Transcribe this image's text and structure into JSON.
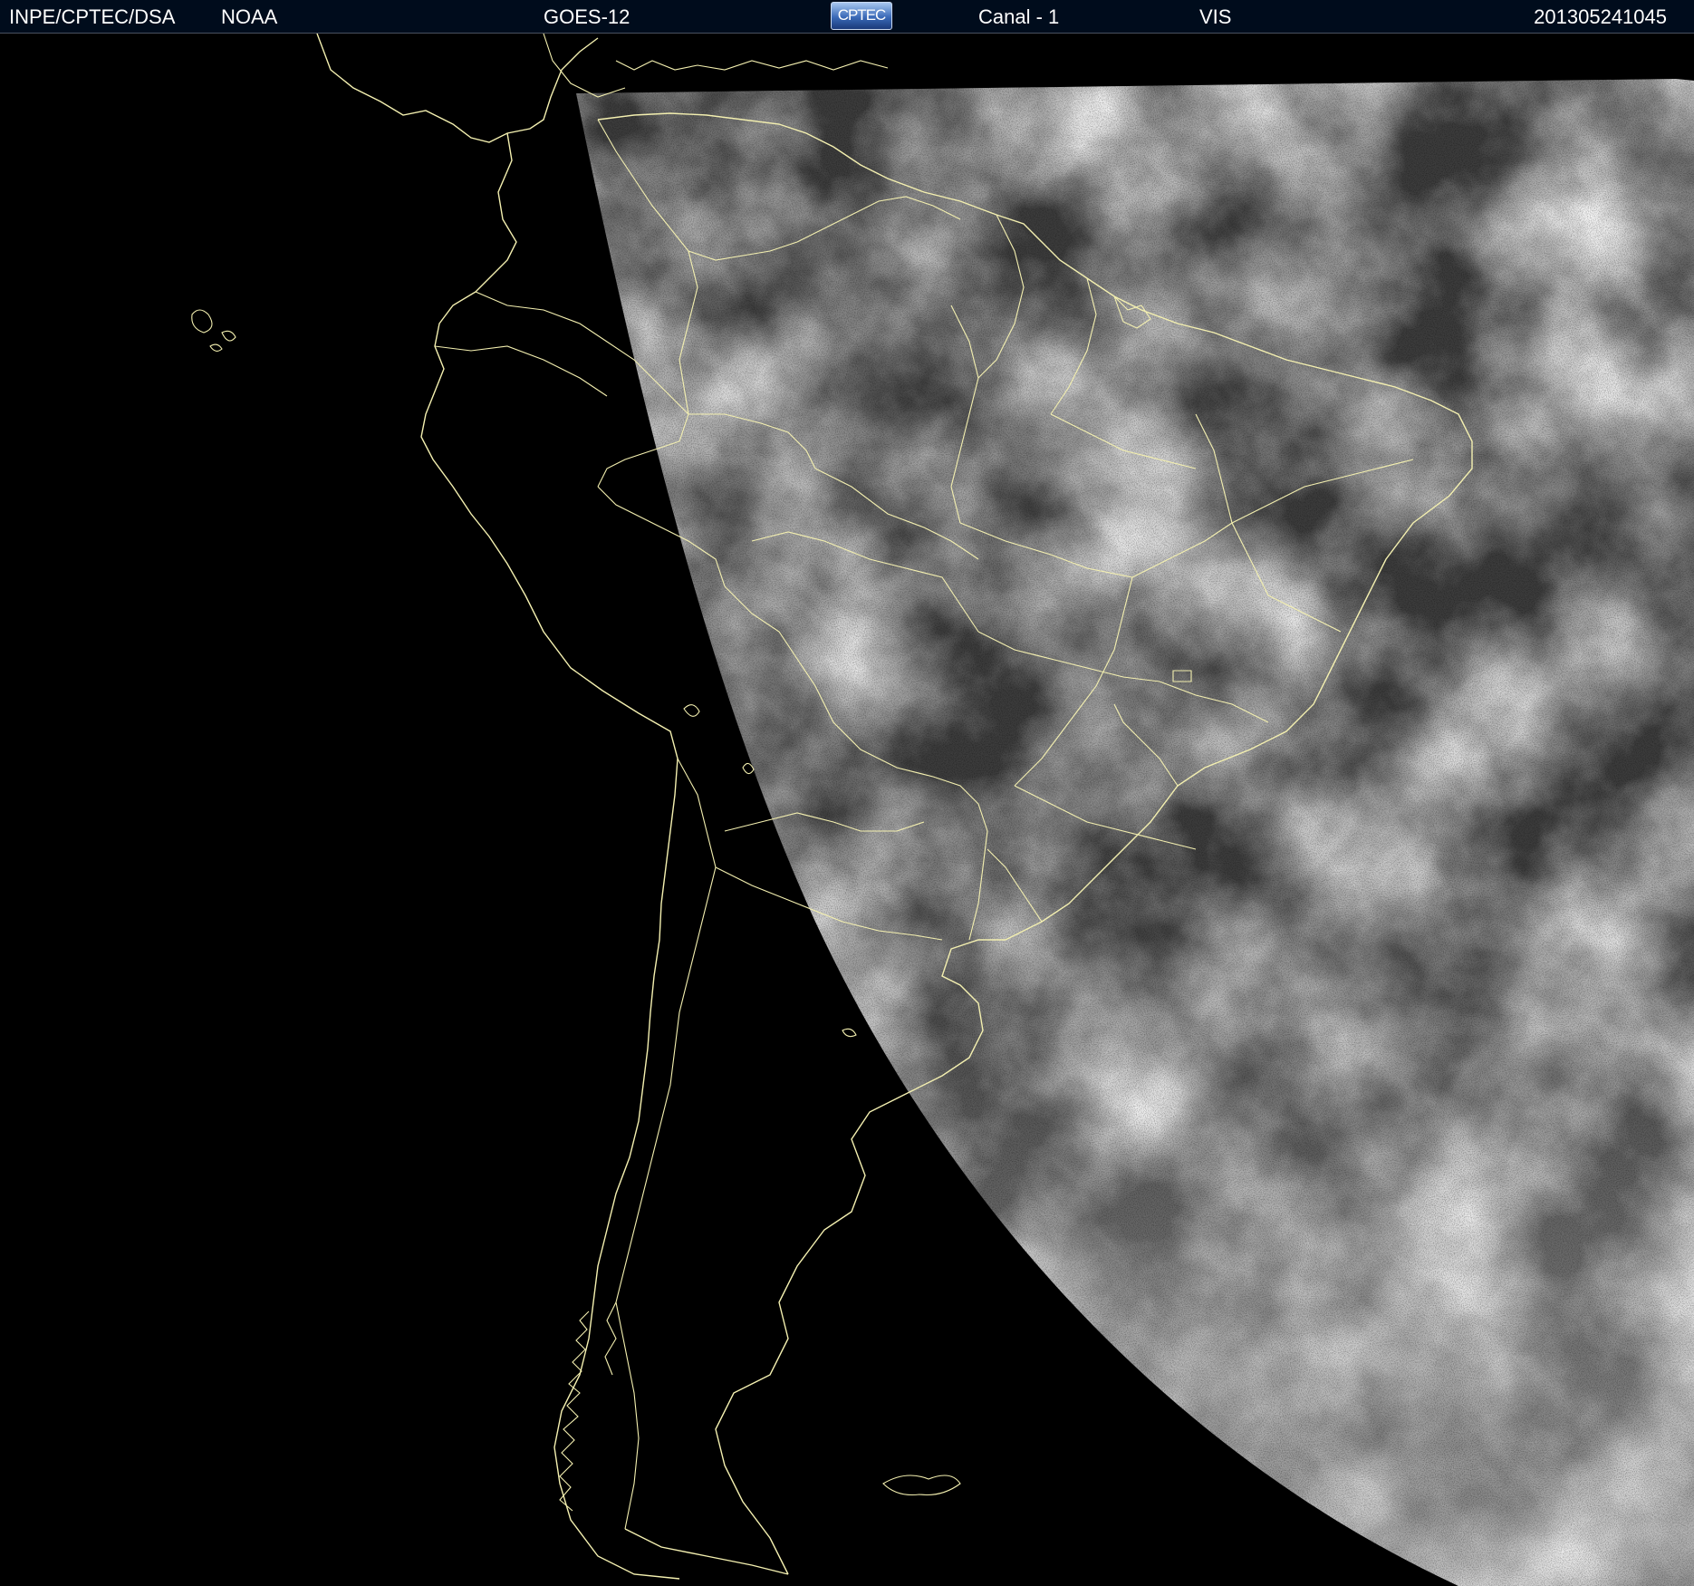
{
  "header": {
    "organization": "INPE/CPTEC/DSA",
    "agency": "NOAA",
    "satellite": "GOES-12",
    "logo_text": "CPTEC",
    "channel": "Canal - 1",
    "band": "VIS",
    "timestamp": "201305241045"
  },
  "image": {
    "kind": "visible-channel satellite image",
    "region": "South America",
    "colors": {
      "background": "#000000",
      "header_bg": "#000c1c",
      "borders": "#f4f0b0",
      "land_ocean": "#3e3e3e",
      "clouds": "#f2f2f2"
    }
  }
}
